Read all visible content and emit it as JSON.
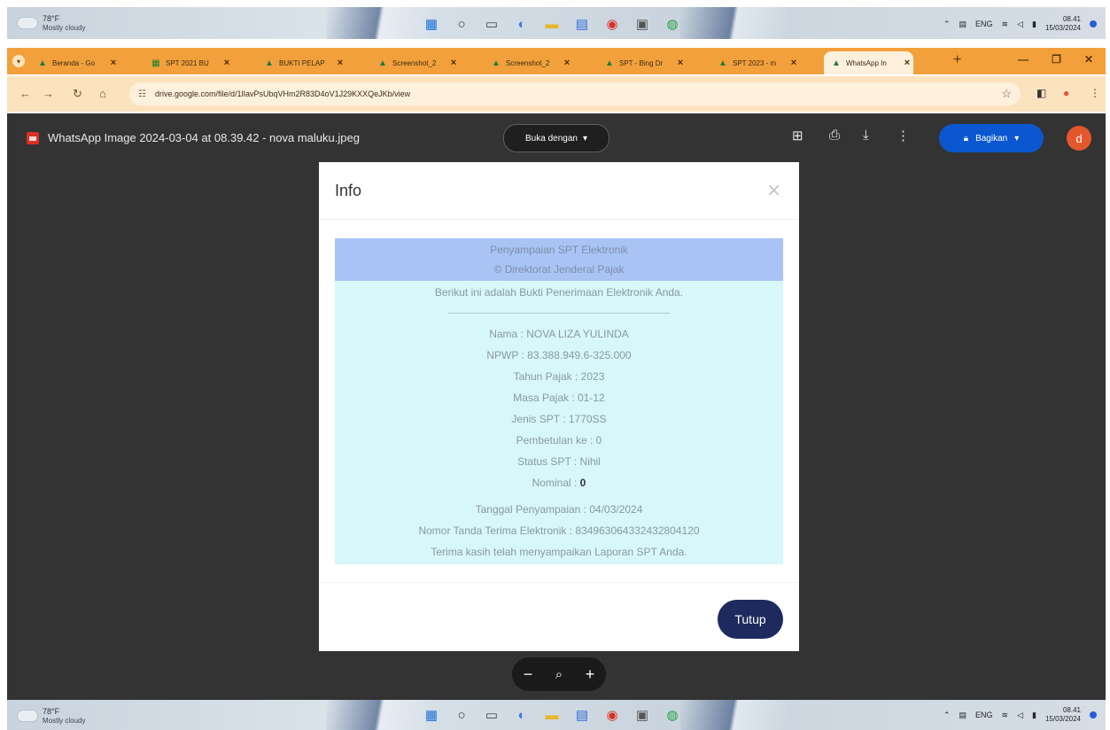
{
  "taskbar": {
    "weather_temp": "78°F",
    "weather_desc": "Mostly cloudy",
    "language": "ENG",
    "time": "08.41",
    "date": "15/03/2024",
    "icons": [
      "windows-start-icon",
      "search-icon",
      "task-view-icon",
      "copilot-icon",
      "file-explorer-icon",
      "store-icon",
      "chrome-icon",
      "camera-icon",
      "whatsapp-icon"
    ]
  },
  "browser": {
    "tabs": [
      {
        "title": "Beranda - Go",
        "favicon": "drive-icon",
        "active": false
      },
      {
        "title": "SPT 2021 BU",
        "favicon": "sheets-icon",
        "active": false
      },
      {
        "title": "BUKTI PELAP",
        "favicon": "drive-icon",
        "active": false
      },
      {
        "title": "Screenshot_2",
        "favicon": "drive-icon",
        "active": false
      },
      {
        "title": "Screenshot_2",
        "favicon": "drive-icon",
        "active": false
      },
      {
        "title": "SPT - Bing Dr",
        "favicon": "drive-icon",
        "active": false
      },
      {
        "title": "SPT 2023 - m",
        "favicon": "drive-icon",
        "active": false
      },
      {
        "title": "WhatsApp In",
        "favicon": "drive-icon",
        "active": true
      }
    ],
    "url": "drive.google.com/file/d/1lIavPsUbqVHm2R83D4oV1J29KXXQeJKb/view"
  },
  "viewer": {
    "filename": "WhatsApp Image 2024-03-04 at 08.39.42 - nova maluku.jpeg",
    "open_with": "Buka dengan",
    "share": "Bagikan",
    "avatar_initial": "d"
  },
  "dialog": {
    "title": "Info",
    "header_line1": "Penyampaian SPT Elektronik",
    "header_line2": "© Direktorat Jenderal Pajak",
    "intro": "Berikut ini adalah Bukti Penerimaan Elektronik Anda.",
    "nama": "Nama : NOVA LIZA YULINDA",
    "npwp": "NPWP : 83.388.949.6-325.000",
    "tahun": "Tahun Pajak : 2023",
    "masa": "Masa Pajak : 01-12",
    "jenis": "Jenis SPT : 1770SS",
    "pembetulan": "Pembetulan ke : 0",
    "status": "Status SPT : Nihil",
    "nominal_label": "Nominal :",
    "nominal_value": "0",
    "tanggal": "Tanggal Penyampaian : 04/03/2024",
    "nomor": "Nomor Tanda Terima Elektronik : 834963064332432804120",
    "thanks": "Terima kasih telah menyampaikan Laporan SPT Anda.",
    "close_button": "Tutup"
  }
}
